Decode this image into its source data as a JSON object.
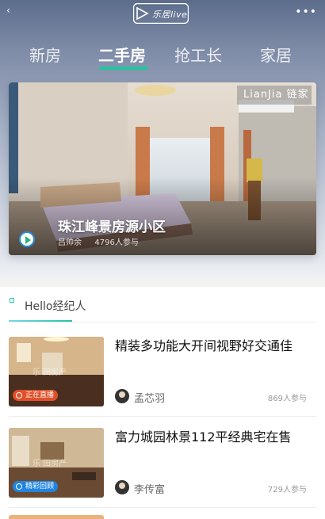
{
  "header": {
    "back_glyph": "‹",
    "logo_text": "乐居live",
    "more_glyph": "•••"
  },
  "tabs": [
    {
      "label": "新房",
      "active": false
    },
    {
      "label": "二手房",
      "active": true
    },
    {
      "label": "抢工长",
      "active": false
    },
    {
      "label": "家居",
      "active": false
    }
  ],
  "banner": {
    "watermark": "LianJia 链家",
    "title": "珠江峰景房源小区",
    "author": "吕帅余",
    "participants": "4796人参与"
  },
  "section": {
    "title": "Hello经纪人"
  },
  "cards": [
    {
      "title": "精装多功能大开间视野好交通佳",
      "badge": "正在直播",
      "badge_color": "#e0502a",
      "agent": "孟芯羽",
      "count": "869人参与",
      "thumb_mark": "乐 田房产"
    },
    {
      "title": "富力城园林景112平经典宅在售",
      "badge": "精彩回顾",
      "badge_color": "#2185e0",
      "agent": "李传富",
      "count": "729人参与",
      "thumb_mark": "乐 田房产"
    }
  ],
  "colors": {
    "accent": "#22c6a0",
    "live_red": "#e0502a",
    "replay_blue": "#2185e0"
  }
}
